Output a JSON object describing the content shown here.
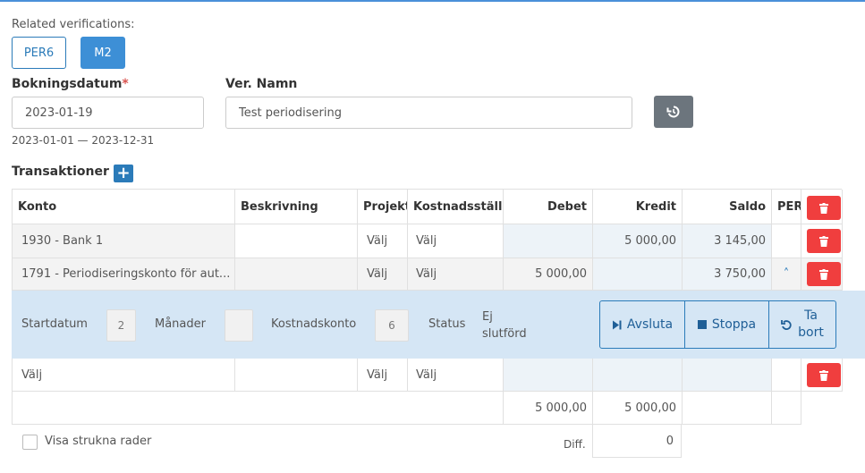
{
  "related": {
    "title": "Related verifications:",
    "chips": [
      "PER6",
      "M2"
    ]
  },
  "form": {
    "date_label": "Bokningsdatum",
    "date_required_mark": "*",
    "date_value": "2023-01-19",
    "date_range": "2023-01-01 — 2023-12-31",
    "name_label": "Ver. Namn",
    "name_value": "Test periodisering"
  },
  "transactions": {
    "title": "Transaktioner",
    "add_label": "+",
    "headers": [
      "Konto",
      "Beskrivning",
      "Projekt",
      "Kostnadsställe",
      "Debet",
      "Kredit",
      "Saldo",
      "PER"
    ],
    "rows": [
      {
        "konto": "1930 - Bank 1",
        "beskrivning": "",
        "projekt": "Välj",
        "kostnadsstalle": "Välj",
        "debet": "",
        "kredit": "5 000,00",
        "saldo": "3 145,00",
        "per": ""
      },
      {
        "konto": "1791 - Periodiseringskonto för aut...",
        "beskrivning": "",
        "projekt": "Välj",
        "kostnadsstalle": "Välj",
        "debet": "5 000,00",
        "kredit": "",
        "saldo": "3 750,00",
        "per": "˄"
      },
      {
        "konto": "Välj",
        "beskrivning": "",
        "projekt": "Välj",
        "kostnadsstalle": "Välj",
        "debet": "",
        "kredit": "",
        "saldo": "",
        "per": ""
      }
    ],
    "periodization": {
      "start_label": "Startdatum",
      "start_value": "2",
      "months_label": "Månader",
      "months_value": "",
      "cost_account_label": "Kostnadskonto",
      "cost_account_value": "6",
      "status_label": "Status",
      "status_value_line1": "Ej",
      "status_value_line2": "slutförd",
      "btn_finish": "Avsluta",
      "btn_stop": "Stoppa",
      "btn_remove_line1": "Ta",
      "btn_remove_line2": "bort"
    },
    "totals": {
      "debet": "5 000,00",
      "kredit": "5 000,00"
    },
    "diff_label": "Diff.",
    "diff_value": "0",
    "show_struck_label": "Visa strukna rader"
  },
  "colors": {
    "accent": "#3d8fd6",
    "danger": "#f03e3e",
    "panel": "#d5e6f5"
  },
  "icons": {
    "history": "history-icon",
    "delete": "trash-icon",
    "chevron": "chevron-up-icon",
    "finish": "step-forward-icon",
    "stop": "stop-icon",
    "undo": "undo-icon"
  }
}
